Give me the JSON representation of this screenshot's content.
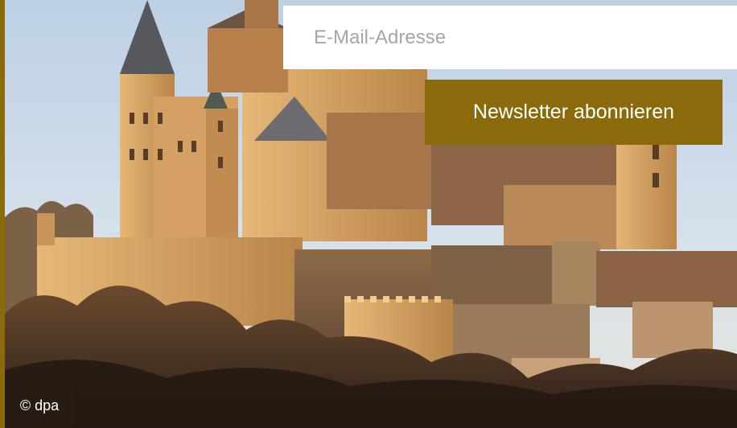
{
  "newsletter": {
    "email_placeholder": "E-Mail-Adresse",
    "subscribe_label": "Newsletter abonnieren"
  },
  "image": {
    "subject": "castle-on-hill-photo",
    "credit": "© dpa"
  },
  "colors": {
    "accent": "#8a6a0b",
    "sky": "#c9d9ea",
    "stone": "#c89a5a"
  }
}
